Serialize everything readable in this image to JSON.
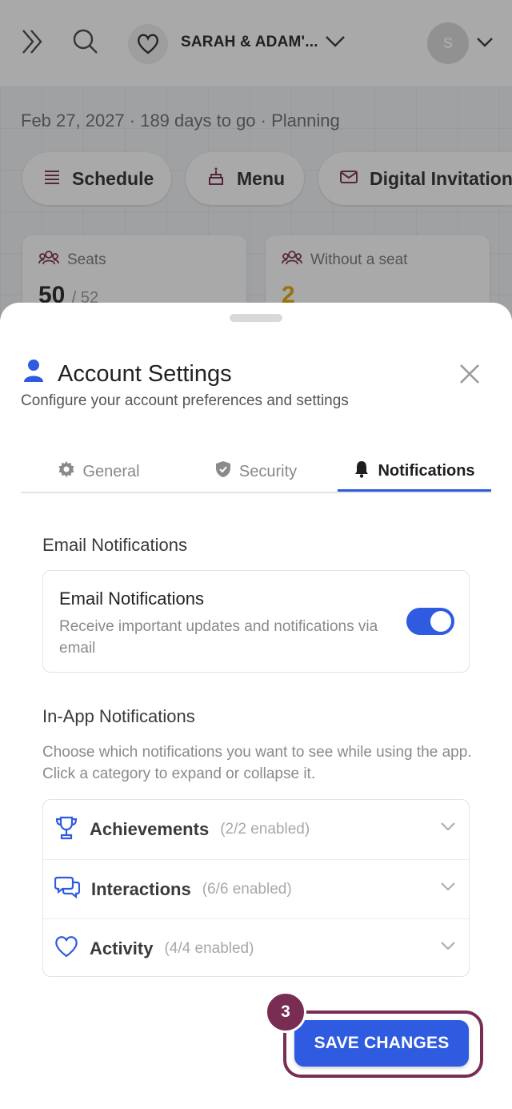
{
  "app": {
    "couple_name": "SARAH & ADAM'...",
    "avatar_initial": "S",
    "subtitle": "Feb 27, 2027 · 189 days to go · Planning",
    "pills": [
      {
        "label": "Schedule",
        "icon": "list-icon"
      },
      {
        "label": "Menu",
        "icon": "cake-icon"
      },
      {
        "label": "Digital Invitation",
        "icon": "envelope-icon"
      }
    ],
    "stats": [
      {
        "label": "Seats",
        "value": "50",
        "total": "/ 52",
        "icon": "people-icon"
      },
      {
        "label": "Without a seat",
        "value": "2",
        "icon": "people-icon",
        "value_color": "#e0a800"
      }
    ]
  },
  "sheet": {
    "title": "Account Settings",
    "subtitle": "Configure your account preferences and settings",
    "tabs": [
      {
        "label": "General",
        "icon": "gear-icon"
      },
      {
        "label": "Security",
        "icon": "shield-icon"
      },
      {
        "label": "Notifications",
        "icon": "bell-icon",
        "active": true
      }
    ],
    "email_section_title": "Email Notifications",
    "email_card": {
      "title": "Email Notifications",
      "description": "Receive important updates and notifications via email",
      "enabled": true
    },
    "inapp_section_title": "In-App Notifications",
    "inapp_description": "Choose which notifications you want to see while using the app. Click a category to expand or collapse it.",
    "categories": [
      {
        "name": "Achievements",
        "count": "(2/2 enabled)",
        "icon": "trophy-icon"
      },
      {
        "name": "Interactions",
        "count": "(6/6 enabled)",
        "icon": "chat-bubbles-icon"
      },
      {
        "name": "Activity",
        "count": "(4/4 enabled)",
        "icon": "heart-icon"
      }
    ],
    "save_label": "SAVE CHANGES",
    "step_badge": "3"
  },
  "colors": {
    "accent": "#2f5be0",
    "highlight": "#7a2d52",
    "warning": "#e0a800"
  }
}
